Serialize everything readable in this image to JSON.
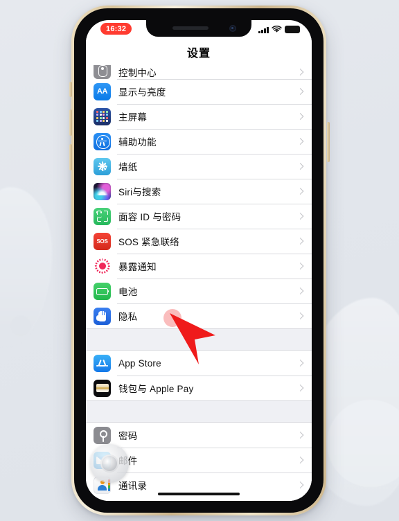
{
  "device": {
    "frame_color": "#d9c49a",
    "bezel_color": "#0a0a0c",
    "screen_background": "#ffffff"
  },
  "status_bar": {
    "time": "16:32",
    "time_pill_color": "#ff3b30",
    "cellular_icon": "signal-bars-icon",
    "wifi_icon": "wifi-icon",
    "battery_icon": "battery-icon"
  },
  "navbar": {
    "title": "设置"
  },
  "groups": [
    {
      "clipped_top": true,
      "rows": [
        {
          "label": "控制中心",
          "icon": "control-center-icon",
          "clipped": true
        },
        {
          "label": "显示与亮度",
          "icon": "display-brightness-icon"
        },
        {
          "label": "主屏幕",
          "icon": "home-screen-icon"
        },
        {
          "label": "辅助功能",
          "icon": "accessibility-icon"
        },
        {
          "label": "墙纸",
          "icon": "wallpaper-icon"
        },
        {
          "label": "Siri与搜索",
          "icon": "siri-icon"
        },
        {
          "label": "面容 ID 与密码",
          "icon": "face-id-icon"
        },
        {
          "label": "SOS 紧急联络",
          "icon": "emergency-sos-icon"
        },
        {
          "label": "暴露通知",
          "icon": "exposure-notification-icon"
        },
        {
          "label": "电池",
          "icon": "battery-settings-icon"
        },
        {
          "label": "隐私",
          "icon": "privacy-hand-icon"
        }
      ]
    },
    {
      "rows": [
        {
          "label": "App Store",
          "icon": "app-store-icon"
        },
        {
          "label": "钱包与 Apple Pay",
          "icon": "wallet-icon"
        }
      ]
    },
    {
      "rows": [
        {
          "label": "密码",
          "icon": "passwords-key-icon"
        },
        {
          "label": "邮件",
          "icon": "mail-icon"
        },
        {
          "label": "通讯录",
          "icon": "contacts-icon"
        }
      ]
    }
  ],
  "chevron_icon": "chevron-right-icon",
  "cursor": {
    "icon": "arrow-cursor-icon",
    "color": "#ef1b1b",
    "tap_highlight_color": "#f46c6c",
    "points_at": "隐私"
  },
  "floating_bubble": {
    "icon": "screen-recorder-bubble-icon"
  },
  "home_indicator": {
    "icon": "home-indicator-bar"
  }
}
